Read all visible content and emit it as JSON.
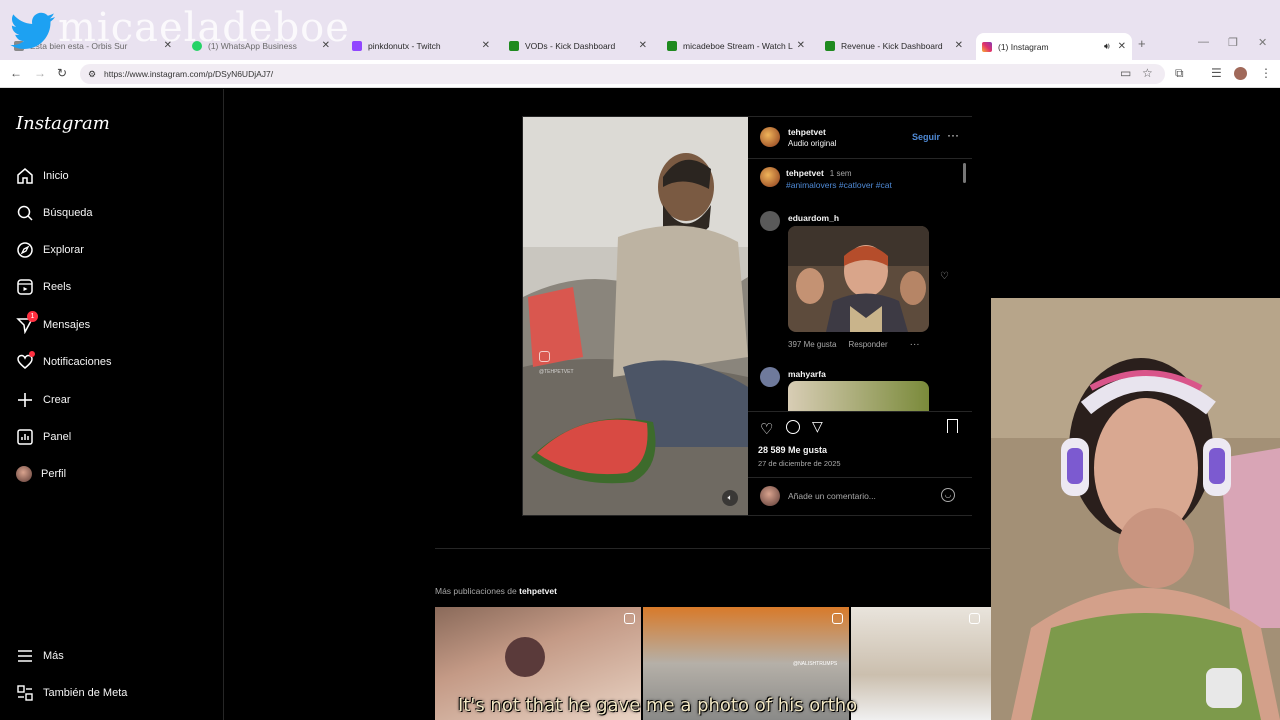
{
  "overlay": {
    "name": "micaeladeboe"
  },
  "browser": {
    "tabs": [
      {
        "title": "Esta bien esta - Orbis Sur",
        "active": false
      },
      {
        "title": "(1) WhatsApp Business",
        "active": false
      },
      {
        "title": "pinkdonutx - Twitch",
        "active": false
      },
      {
        "title": "VODs - Kick Dashboard",
        "active": false
      },
      {
        "title": "micadeboe Stream - Watch Live",
        "active": false
      },
      {
        "title": "Revenue - Kick Dashboard",
        "active": false
      },
      {
        "title": "(1) Instagram",
        "active": true
      }
    ],
    "url": "https://www.instagram.com/p/DSyN6UDjAJ7/"
  },
  "sidebar": {
    "logo": "Instagram",
    "items": [
      {
        "label": "Inicio",
        "icon": "home-icon"
      },
      {
        "label": "Búsqueda",
        "icon": "search-icon"
      },
      {
        "label": "Explorar",
        "icon": "compass-icon"
      },
      {
        "label": "Reels",
        "icon": "reels-icon"
      },
      {
        "label": "Mensajes",
        "icon": "messenger-icon",
        "badge": "1"
      },
      {
        "label": "Notificaciones",
        "icon": "heart-icon"
      },
      {
        "label": "Crear",
        "icon": "plus-icon"
      },
      {
        "label": "Panel",
        "icon": "dashboard-icon"
      },
      {
        "label": "Perfil",
        "icon": "profile-avatar"
      }
    ],
    "bottom": [
      {
        "label": "Más",
        "icon": "menu-icon"
      },
      {
        "label": "También de Meta",
        "icon": "meta-icon"
      }
    ]
  },
  "post": {
    "author": "tehpetvet",
    "audio": "Audio original",
    "follow": "Seguir",
    "video_watermark": "@TEHPETVET",
    "caption_author": "tehpetvet",
    "caption_time": "1 sem",
    "caption_tags": "#animalovers #catlover #cat",
    "comments": [
      {
        "user": "eduardom_h",
        "likes": "397 Me gusta",
        "reply": "Responder"
      },
      {
        "user": "mahyarfa"
      }
    ],
    "likes": "28 589 Me gusta",
    "date": "27 de diciembre de 2025",
    "add_comment_placeholder": "Añade un comentario..."
  },
  "more_posts": {
    "prefix": "Más publicaciones de",
    "user": "tehpetvet",
    "thumb_watermark": "@NALISHTRUMPS"
  },
  "subtitle": "It's not that he gave me a photo of his ortho",
  "colors": {
    "accent": "#4f8ad6",
    "badge": "#ff3040",
    "tabbar": "#e9e2f0"
  }
}
